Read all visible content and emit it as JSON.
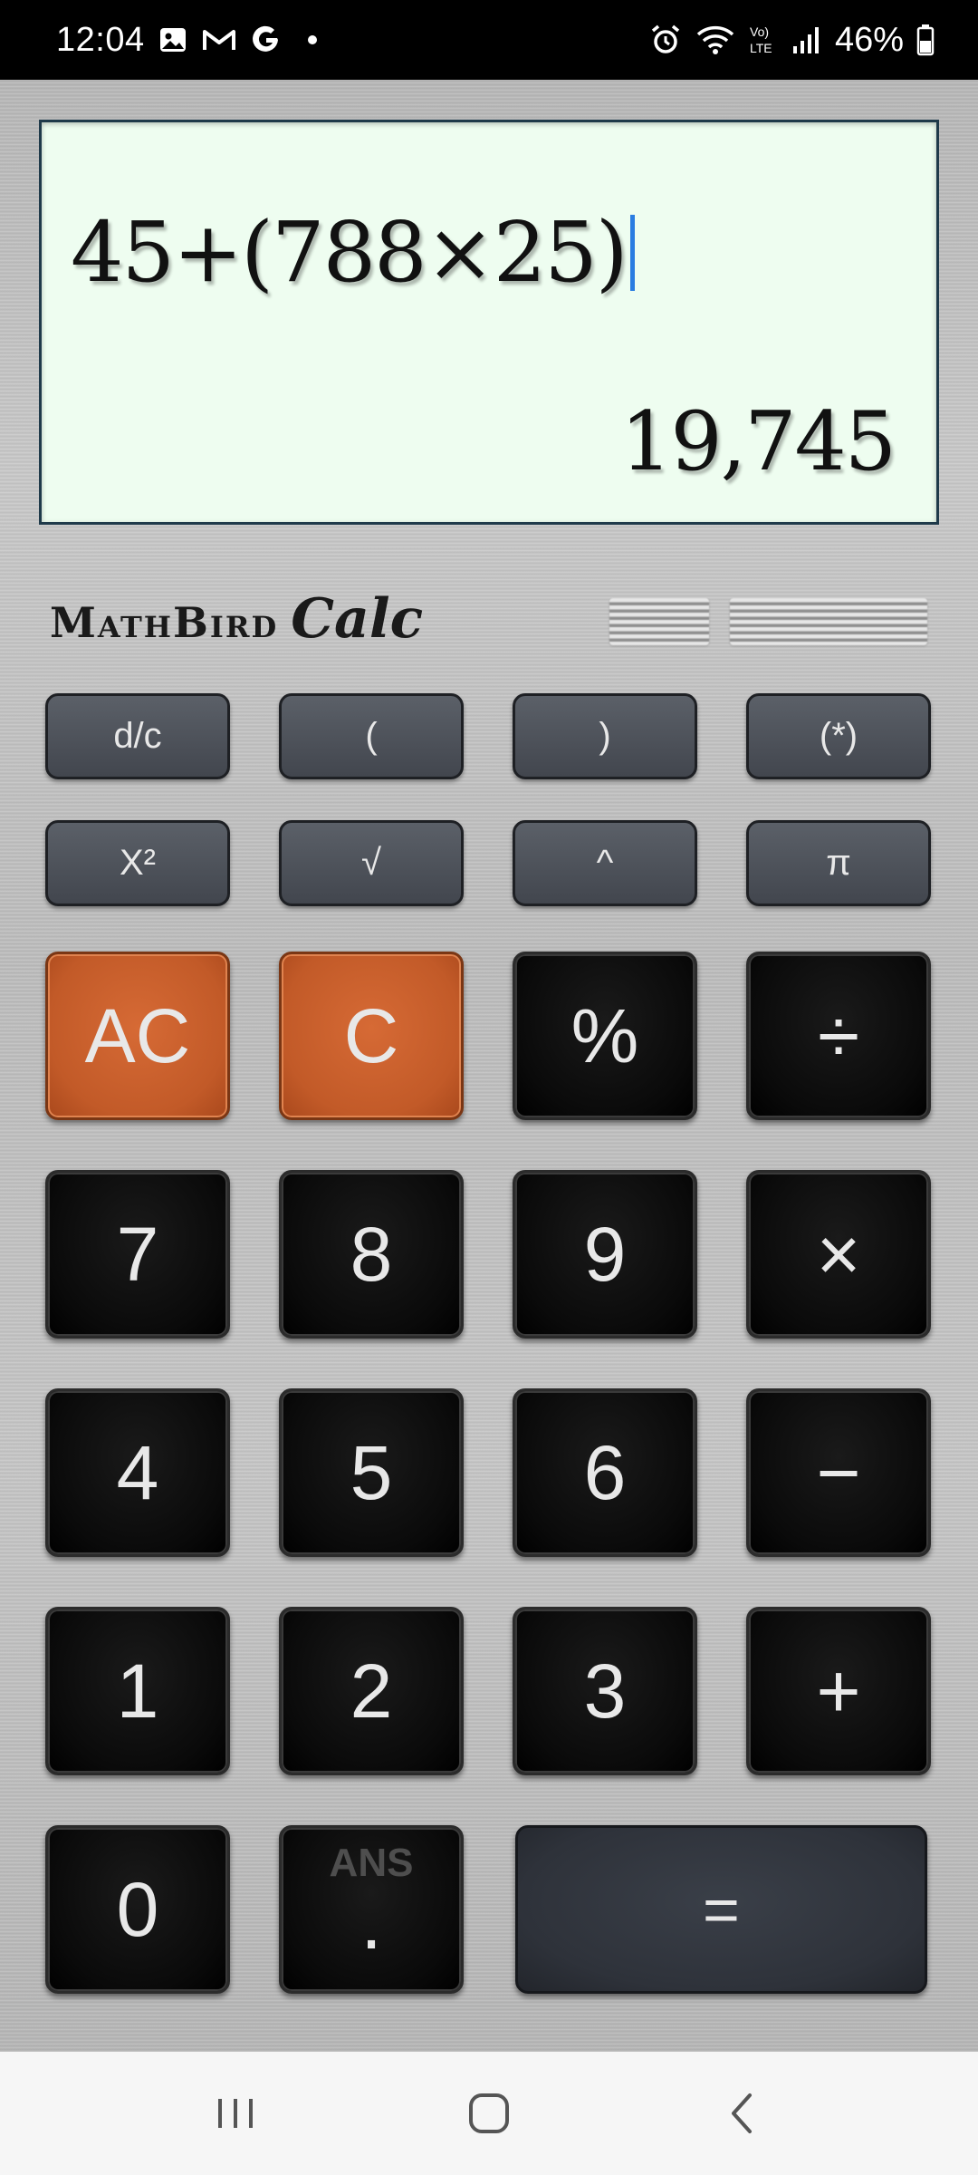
{
  "status_bar": {
    "time": "12:04",
    "battery": "46%",
    "icons_left": [
      "gallery-icon",
      "gmail-icon",
      "google-icon",
      "notification-dot-icon"
    ],
    "icons_right": [
      "alarm-icon",
      "wifi-icon",
      "volte-icon",
      "signal-icon",
      "battery-icon"
    ]
  },
  "display": {
    "expression": "45+(788×25)",
    "result": "19,745"
  },
  "brand": {
    "name": "MathBird",
    "sub": "Calc"
  },
  "keys": {
    "dc": "d/c",
    "lparen": "(",
    "rparen": ")",
    "star": "(*)",
    "square": "X²",
    "sqrt": "√",
    "power": "^",
    "pi": "π",
    "ac": "AC",
    "c": "C",
    "percent": "%",
    "divide": "÷",
    "seven": "7",
    "eight": "8",
    "nine": "9",
    "multiply": "×",
    "four": "4",
    "five": "5",
    "six": "6",
    "minus": "−",
    "one": "1",
    "two": "2",
    "three": "3",
    "plus": "+",
    "zero": "0",
    "ans": "ANS",
    "dot": ".",
    "equals": "="
  },
  "colors": {
    "display_bg": "#eefdf0",
    "orange_key": "#c95f2c",
    "dark_key": "#0b0b0b",
    "small_key": "#4a4e56",
    "cursor": "#2a7de1"
  },
  "nav": [
    "recent-apps-icon",
    "home-icon",
    "back-icon"
  ]
}
